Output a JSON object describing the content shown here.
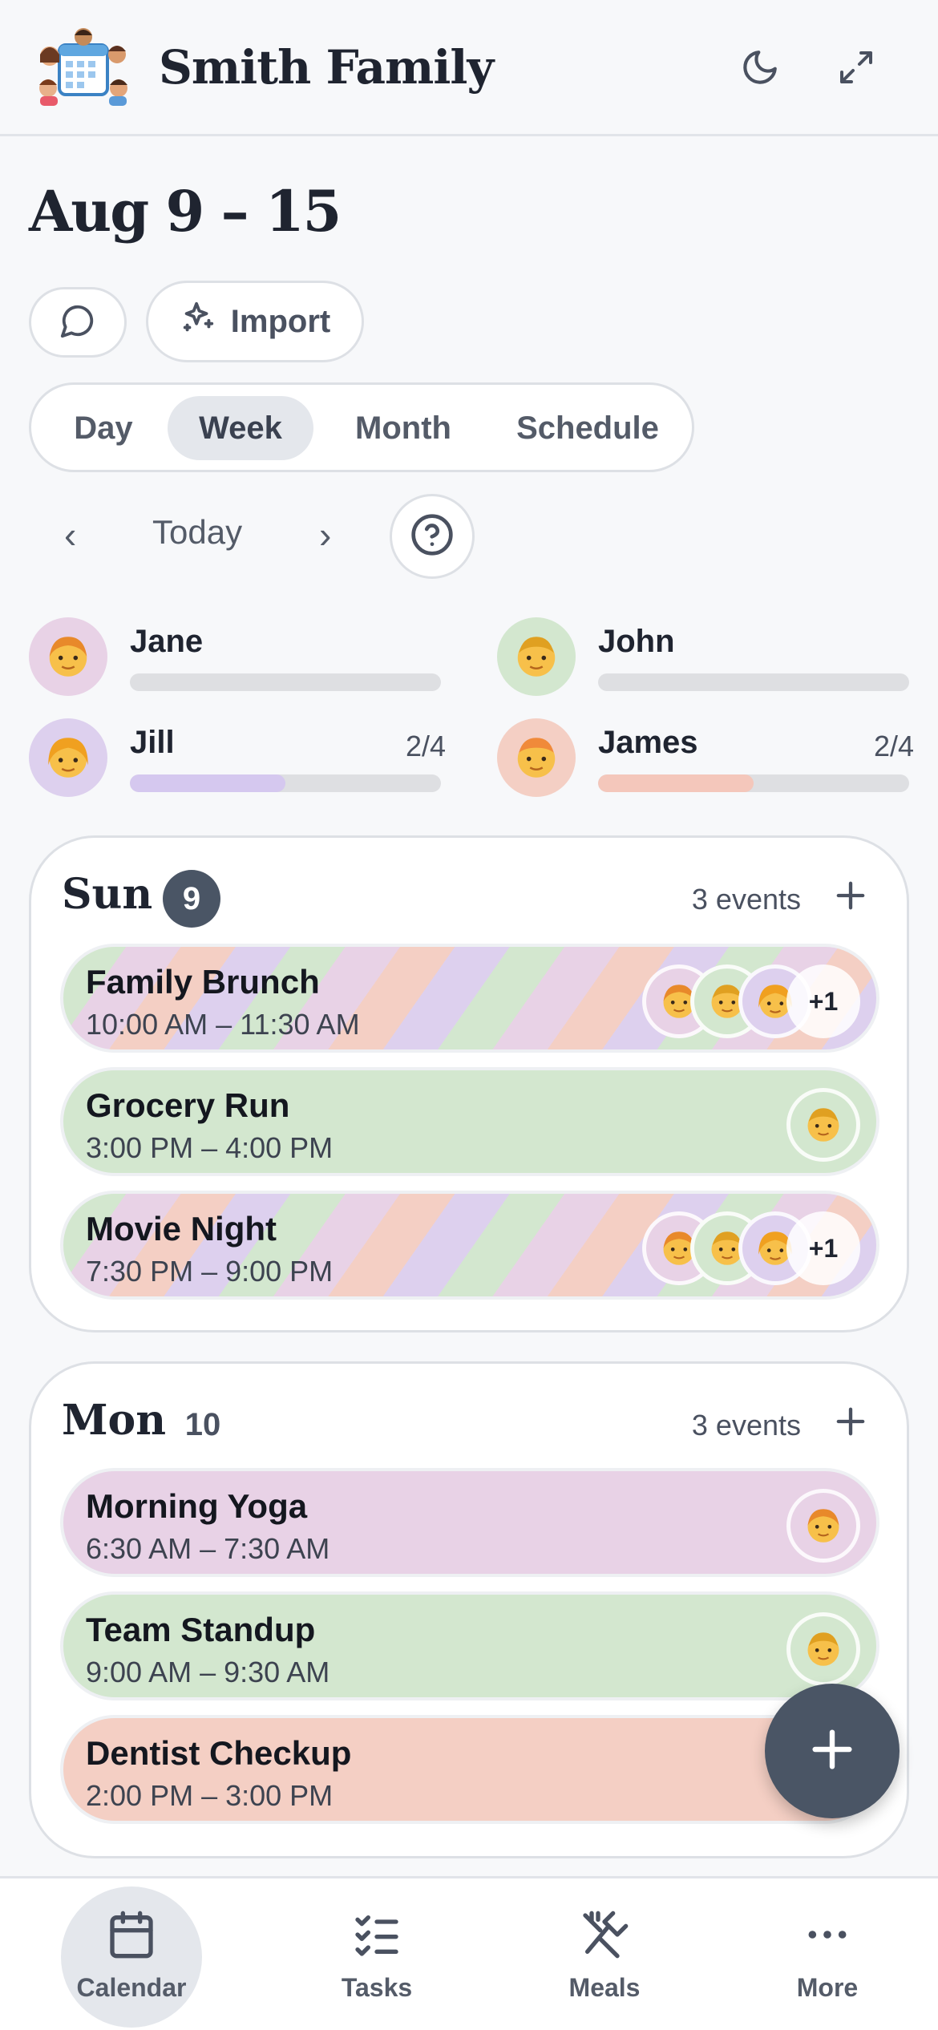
{
  "header": {
    "app_title": "Smith Family",
    "logo_icon": "family-calendar-logo",
    "theme_icon": "moon-icon",
    "expand_icon": "expand-icon"
  },
  "range_title": "Aug 9 – 15",
  "actions": {
    "chat_icon": "chat-bubble-icon",
    "import_label": "Import",
    "import_icon": "sparkles-icon"
  },
  "view_tabs": [
    "Day",
    "Week",
    "Month",
    "Schedule"
  ],
  "active_view": "Week",
  "navigation": {
    "prev": "‹",
    "today": "Today",
    "next": "›",
    "help_icon": "help-circle-icon"
  },
  "members": [
    {
      "name": "Jane",
      "count": "",
      "progress": 0,
      "color": "#e8d2e6",
      "fill": "#c9b3e6"
    },
    {
      "name": "John",
      "count": "",
      "progress": 0,
      "color": "#d3e7cf",
      "fill": "#bcdcb5"
    },
    {
      "name": "Jill",
      "count": "2/4",
      "progress": 0.5,
      "color": "#ddd0ee",
      "fill": "#d5c8ef"
    },
    {
      "name": "James",
      "count": "2/4",
      "progress": 0.5,
      "color": "#f4cfc4",
      "fill": "#f4c7bb"
    }
  ],
  "days": [
    {
      "name": "Sun",
      "number": "9",
      "is_today": true,
      "events_count": "3 events",
      "events": [
        {
          "title": "Family Brunch",
          "time": "10:00 AM – 11:30 AM",
          "style": "stripes",
          "more": "+1"
        },
        {
          "title": "Grocery Run",
          "time": "3:00 PM – 4:00 PM",
          "style": "#d3e7cf",
          "more": ""
        },
        {
          "title": "Movie Night",
          "time": "7:30 PM – 9:00 PM",
          "style": "stripes",
          "more": "+1"
        }
      ]
    },
    {
      "name": "Mon",
      "number": "10",
      "is_today": false,
      "events_count": "3 events",
      "events": [
        {
          "title": "Morning Yoga",
          "time": "6:30 AM – 7:30 AM",
          "style": "#e8d2e6",
          "more": ""
        },
        {
          "title": "Team Standup",
          "time": "9:00 AM – 9:30 AM",
          "style": "#d3e7cf",
          "more": ""
        },
        {
          "title": "Dentist Checkup",
          "time": "2:00 PM – 3:00 PM",
          "style": "#f4cfc4",
          "more": ""
        }
      ]
    }
  ],
  "fab_icon": "plus-icon",
  "bottom_nav": [
    {
      "label": "Calendar",
      "icon": "calendar-icon",
      "active": true
    },
    {
      "label": "Tasks",
      "icon": "checklist-icon",
      "active": false
    },
    {
      "label": "Meals",
      "icon": "utensils-off-icon",
      "active": false
    },
    {
      "label": "More",
      "icon": "more-dots-icon",
      "active": false
    }
  ]
}
